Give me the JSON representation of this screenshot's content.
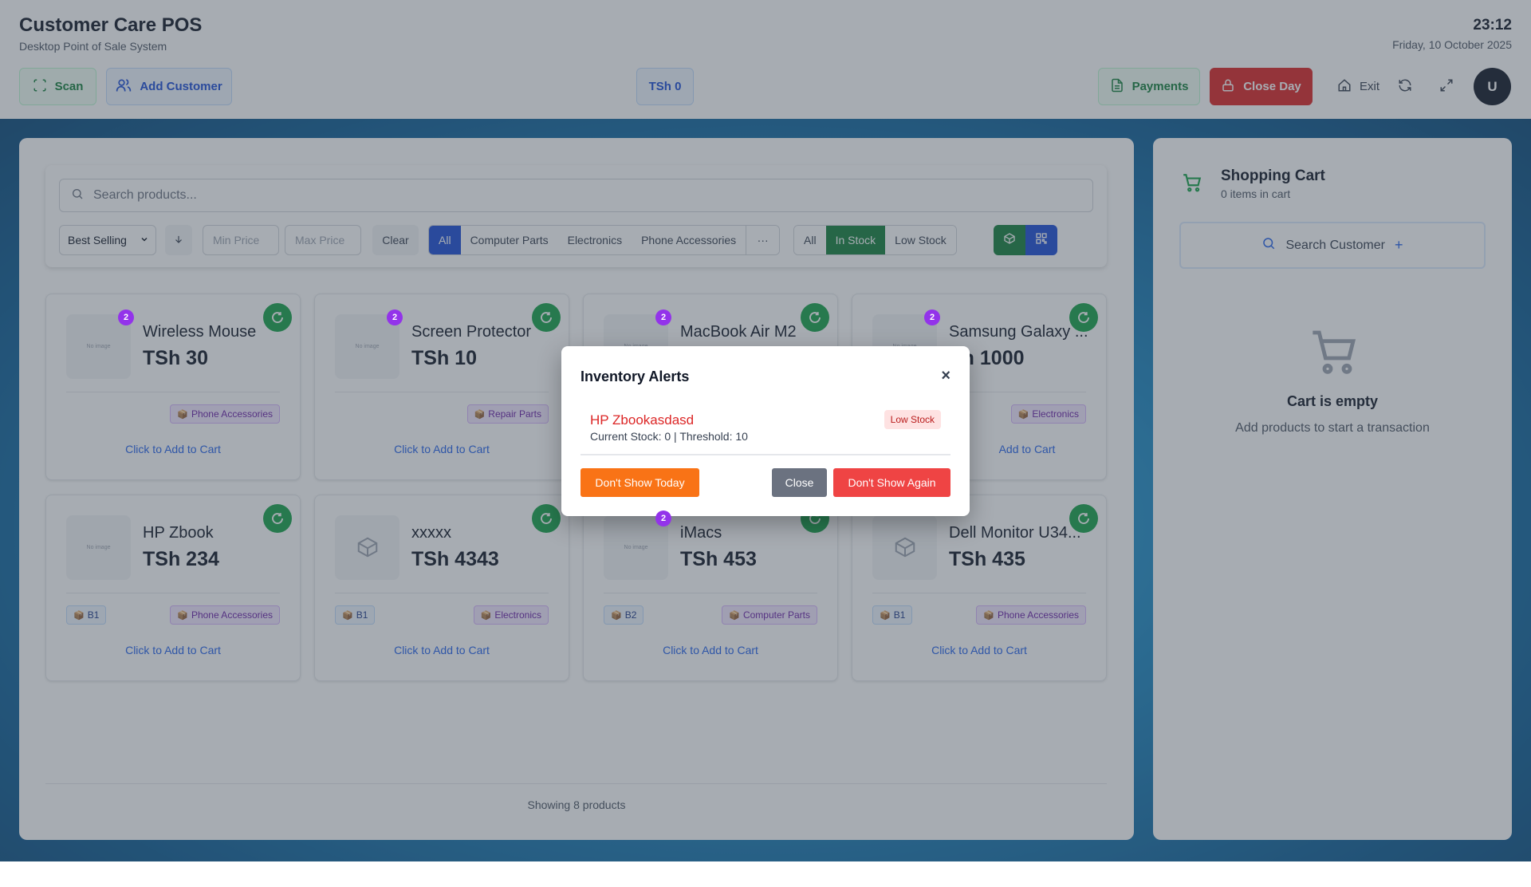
{
  "header": {
    "title": "Customer Care POS",
    "subtitle": "Desktop Point of Sale System",
    "time": "23:12",
    "date": "Friday, 10 October 2025",
    "scan_label": "Scan",
    "add_customer_label": "Add Customer",
    "total_label": "TSh 0",
    "payments_label": "Payments",
    "close_day_label": "Close Day",
    "exit_label": "Exit",
    "avatar_initial": "U"
  },
  "filters": {
    "search_placeholder": "Search products...",
    "sort_value": "Best Selling",
    "min_price_placeholder": "Min Price",
    "max_price_placeholder": "Max Price",
    "clear_label": "Clear",
    "categories": [
      "All",
      "Computer Parts",
      "Electronics",
      "Phone Accessories"
    ],
    "active_category": "All",
    "more_label": "···",
    "stock_filters": [
      "All",
      "In Stock",
      "Low Stock"
    ],
    "active_stock": "In Stock"
  },
  "products": [
    {
      "name": "Wireless Mouse",
      "price": "TSh 30",
      "category": "Phone Accessories",
      "location": "",
      "count": "2",
      "image": "No image"
    },
    {
      "name": "Screen Protector",
      "price": "TSh 10",
      "category": "Repair Parts",
      "location": "",
      "count": "2",
      "image": "No image"
    },
    {
      "name": "MacBook Air M2",
      "price": "",
      "category": "",
      "location": "",
      "count": "2",
      "image": "No image"
    },
    {
      "name": "Samsung Galaxy ...",
      "price": "Sh 1000",
      "category": "Electronics",
      "location": "",
      "count": "2",
      "image": "No image"
    },
    {
      "name": "HP Zbook",
      "price": "TSh 234",
      "category": "Phone Accessories",
      "location": "B1",
      "count": "",
      "image": "No image"
    },
    {
      "name": "xxxxx",
      "price": "TSh 4343",
      "category": "Electronics",
      "location": "B1",
      "count": "",
      "image": "box"
    },
    {
      "name": "iMacs",
      "price": "TSh 453",
      "category": "Computer Parts",
      "location": "B2",
      "count": "2",
      "image": "No image"
    },
    {
      "name": "Dell Monitor U34...",
      "price": "TSh 435",
      "category": "Phone Accessories",
      "location": "B1",
      "count": "",
      "image": "box"
    }
  ],
  "add_to_cart_label": "Click to Add to Cart",
  "add_to_cart_partial": "Add to Cart",
  "footer_text": "Showing 8 products",
  "cart": {
    "title": "Shopping Cart",
    "count_text": "0 items in cart",
    "search_customer_label": "Search Customer",
    "empty_title": "Cart is empty",
    "empty_sub": "Add products to start a transaction"
  },
  "modal": {
    "title": "Inventory Alerts",
    "close_symbol": "×",
    "alert_name": "HP Zbookasdasd",
    "alert_meta": "Current Stock: 0 | Threshold: 10",
    "alert_badge": "Low Stock",
    "dont_show_today": "Don't Show Today",
    "close_label": "Close",
    "dont_show_again": "Don't Show Again"
  },
  "colors": {
    "primary_blue": "#1d4ed8",
    "green": "#15803d",
    "danger": "#dc2626",
    "orange": "#f97316",
    "purple_badge": "#9333ea"
  }
}
